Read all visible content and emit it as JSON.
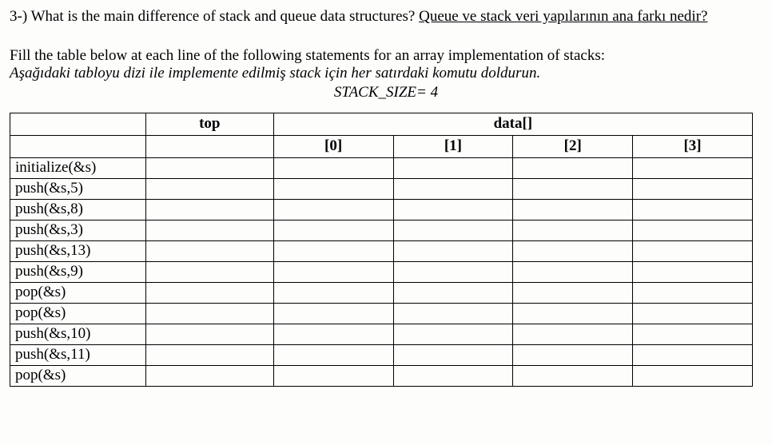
{
  "question": {
    "number_prefix": "3-) ",
    "english": "What is the main difference of stack and queue data structures? ",
    "turkish_underlined": "Queue ve stack veri yapılarının ana farkı nedir?"
  },
  "instructions": {
    "english": "Fill the table below at each line of the following statements for an array implementation of stacks:",
    "turkish_italic": "Aşağıdaki tabloyu dizi ile implemente edilmiş stack için her satırdaki komutu doldurun.",
    "stack_size": "STACK_SIZE= 4"
  },
  "table": {
    "header": {
      "top": "top",
      "data": "data[]",
      "indices": [
        "[0]",
        "[1]",
        "[2]",
        "[3]"
      ]
    },
    "rows": [
      {
        "op": "initialize(&s)",
        "top": "",
        "d0": "",
        "d1": "",
        "d2": "",
        "d3": ""
      },
      {
        "op": "push(&s,5)",
        "top": "",
        "d0": "",
        "d1": "",
        "d2": "",
        "d3": ""
      },
      {
        "op": "push(&s,8)",
        "top": "",
        "d0": "",
        "d1": "",
        "d2": "",
        "d3": ""
      },
      {
        "op": "push(&s,3)",
        "top": "",
        "d0": "",
        "d1": "",
        "d2": "",
        "d3": ""
      },
      {
        "op": "push(&s,13)",
        "top": "",
        "d0": "",
        "d1": "",
        "d2": "",
        "d3": ""
      },
      {
        "op": "push(&s,9)",
        "top": "",
        "d0": "",
        "d1": "",
        "d2": "",
        "d3": ""
      },
      {
        "op": "pop(&s)",
        "top": "",
        "d0": "",
        "d1": "",
        "d2": "",
        "d3": ""
      },
      {
        "op": "pop(&s)",
        "top": "",
        "d0": "",
        "d1": "",
        "d2": "",
        "d3": ""
      },
      {
        "op": "push(&s,10)",
        "top": "",
        "d0": "",
        "d1": "",
        "d2": "",
        "d3": ""
      },
      {
        "op": "push(&s,11)",
        "top": "",
        "d0": "",
        "d1": "",
        "d2": "",
        "d3": ""
      },
      {
        "op": "pop(&s)",
        "top": "",
        "d0": "",
        "d1": "",
        "d2": "",
        "d3": ""
      }
    ]
  }
}
